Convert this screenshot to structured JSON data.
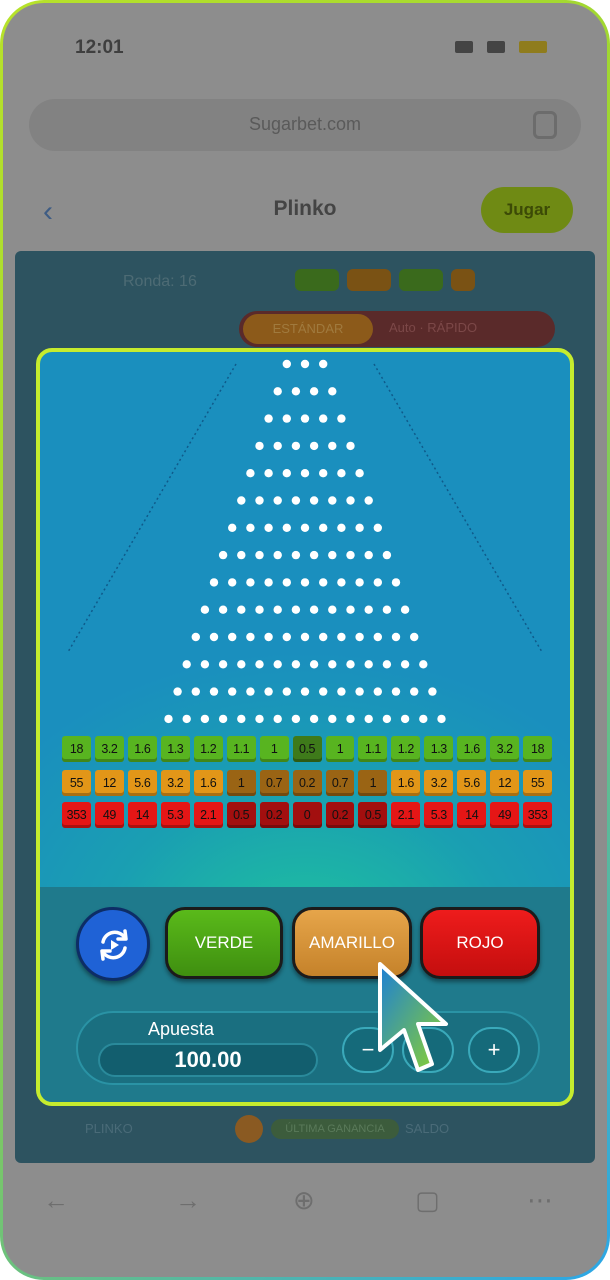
{
  "status_bar": {
    "time": "12:01"
  },
  "browser": {
    "url": "Sugarbet.com"
  },
  "app_bar": {
    "back": "‹",
    "title": "Plinko",
    "play_label": "Jugar"
  },
  "background_game": {
    "stats_text": "Ronda: 16",
    "tab_active": "ESTÁNDAR",
    "tab_inactive": "Auto · RÁPIDO",
    "footer_left": "PLINKO",
    "footer_mid": "ÚLTIMA GANANCIA",
    "footer_right": "SALDO"
  },
  "multipliers": {
    "green": [
      "18",
      "3.2",
      "1.6",
      "1.3",
      "1.2",
      "1.1",
      "1",
      "0.5",
      "1",
      "1.1",
      "1.2",
      "1.3",
      "1.6",
      "3.2",
      "18"
    ],
    "orange": [
      "55",
      "12",
      "5.6",
      "3.2",
      "1.6",
      "1",
      "0.7",
      "0.2",
      "0.7",
      "1",
      "1.6",
      "3.2",
      "5.6",
      "12",
      "55"
    ],
    "red": [
      "353",
      "49",
      "14",
      "5.3",
      "2.1",
      "0.5",
      "0.2",
      "0",
      "0.2",
      "0.5",
      "2.1",
      "5.3",
      "14",
      "49",
      "353"
    ]
  },
  "controls": {
    "verde_label": "VERDE",
    "amarillo_label": "AMARILLO",
    "rojo_label": "ROJO",
    "bet_label": "Apuesta",
    "bet_value": "100.00",
    "minus_label": "−",
    "plus_label": "+"
  },
  "colors": {
    "frame_highlight": "#c6ec2e",
    "verde": "#4aa314",
    "amarillo": "#d99440",
    "rojo": "#e01414",
    "refresh": "#1f62d6"
  }
}
